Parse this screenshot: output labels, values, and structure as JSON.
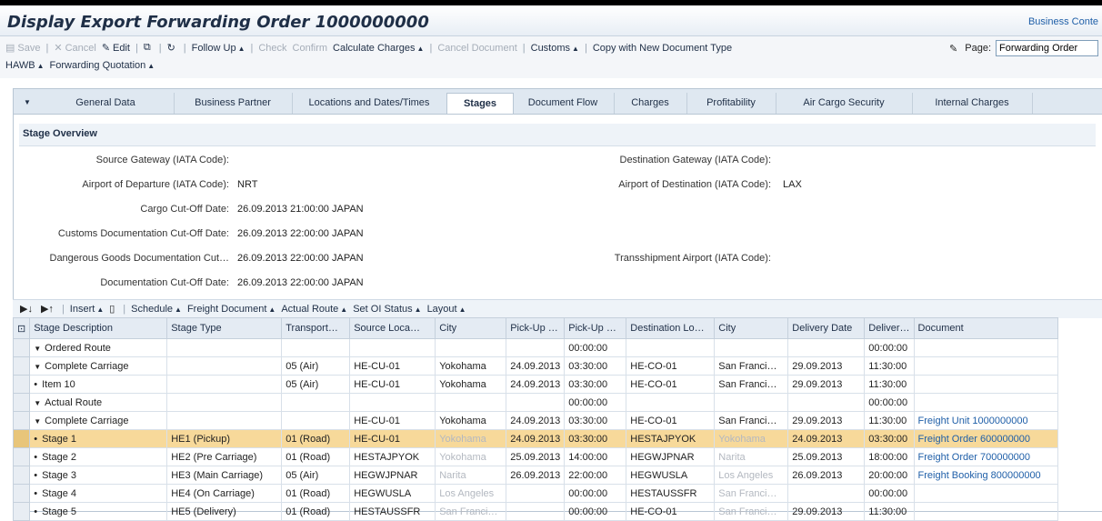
{
  "title": "Display Export Forwarding Order 1000000000",
  "business_context": "Business Conte",
  "toolbar": {
    "row1": [
      {
        "label": "Save",
        "disabled": true,
        "icon": "save-icon"
      },
      {
        "sep": true
      },
      {
        "label": "Cancel",
        "disabled": true,
        "icon": "cancel-icon"
      },
      {
        "label": "Edit",
        "disabled": false,
        "icon": "edit-icon"
      },
      {
        "sep": true
      },
      {
        "label": "",
        "disabled": false,
        "icon": "copy-icon"
      },
      {
        "sep": true
      },
      {
        "label": "",
        "disabled": false,
        "icon": "refresh-icon"
      },
      {
        "sep": true
      },
      {
        "label": "Follow Up",
        "disabled": false,
        "drop": true
      },
      {
        "sep": true
      },
      {
        "label": "Check",
        "disabled": true
      },
      {
        "label": "Confirm",
        "disabled": true
      },
      {
        "label": "Calculate Charges",
        "disabled": false,
        "drop": true
      },
      {
        "sep": true
      },
      {
        "label": "Cancel Document",
        "disabled": true
      },
      {
        "sep": true
      },
      {
        "label": "Customs",
        "disabled": false,
        "drop": true
      },
      {
        "sep": true
      },
      {
        "label": "Copy with New Document Type",
        "disabled": false
      }
    ],
    "row2": [
      {
        "label": "HAWB",
        "drop": true
      },
      {
        "label": "Forwarding Quotation",
        "drop": true
      }
    ],
    "page_label": "Page:",
    "page_value": "Forwarding Order"
  },
  "tabs": [
    "General Data",
    "Business Partner",
    "Locations and Dates/Times",
    "Stages",
    "Document Flow",
    "Charges",
    "Profitability",
    "Air Cargo Security",
    "Internal Charges"
  ],
  "active_tab": "Stages",
  "overview": {
    "heading": "Stage Overview",
    "left": [
      {
        "label": "Source Gateway (IATA Code):",
        "value": ""
      },
      {
        "label": "Airport of Departure (IATA Code):",
        "value": "NRT"
      },
      {
        "label": "Cargo Cut-Off Date:",
        "value": "26.09.2013 21:00:00 JAPAN"
      },
      {
        "label": "Customs Documentation Cut-Off Date:",
        "value": "26.09.2013 22:00:00 JAPAN"
      },
      {
        "label": "Dangerous Goods Documentation Cut…",
        "value": "26.09.2013 22:00:00 JAPAN"
      },
      {
        "label": "Documentation Cut-Off Date:",
        "value": "26.09.2013 22:00:00 JAPAN"
      }
    ],
    "right": [
      {
        "label": "Destination Gateway (IATA Code):",
        "value": ""
      },
      {
        "label": "Airport of Destination (IATA Code):",
        "value": "LAX"
      },
      {
        "label": "Transshipment Airport (IATA Code):",
        "value": ""
      }
    ]
  },
  "grid_toolbar": [
    "Insert",
    "Schedule",
    "Freight Document",
    "Actual Route",
    "Set OI Status",
    "Layout"
  ],
  "columns": [
    "Stage Description",
    "Stage Type",
    "Transport…",
    "Source Loca…",
    "City",
    "Pick-Up …",
    "Pick-Up …",
    "Destination Lo…",
    "City",
    "Delivery Date",
    "Deliver…",
    "Document"
  ],
  "rows": [
    {
      "level": 0,
      "tri": "▼",
      "desc": "Ordered Route",
      "cells": [
        "",
        "",
        "",
        "",
        "",
        "00:00:00",
        "",
        "",
        "",
        "00:00:00",
        ""
      ]
    },
    {
      "level": 1,
      "tri": "▼",
      "desc": "Complete Carriage",
      "cells": [
        "",
        "05 (Air)",
        "HE-CU-01",
        "Yokohama",
        "24.09.2013",
        "03:30:00",
        "HE-CO-01",
        "San Franci…",
        "29.09.2013",
        "11:30:00",
        ""
      ]
    },
    {
      "level": 2,
      "tri": "•",
      "desc": "Item 10",
      "cells": [
        "",
        "05 (Air)",
        "HE-CU-01",
        "Yokohama",
        "24.09.2013",
        "03:30:00",
        "HE-CO-01",
        "San Franci…",
        "29.09.2013",
        "11:30:00",
        ""
      ]
    },
    {
      "level": 0,
      "tri": "▼",
      "desc": "Actual Route",
      "cells": [
        "",
        "",
        "",
        "",
        "",
        "00:00:00",
        "",
        "",
        "",
        "00:00:00",
        ""
      ]
    },
    {
      "level": 1,
      "tri": "▼",
      "desc": "Complete Carriage",
      "cells": [
        "",
        "",
        "HE-CU-01",
        "Yokohama",
        "24.09.2013",
        "03:30:00",
        "HE-CO-01",
        "San Franci…",
        "29.09.2013",
        "11:30:00",
        "Freight Unit 1000000000"
      ]
    },
    {
      "level": 2,
      "tri": "•",
      "desc": "Stage 1",
      "hl": true,
      "cells": [
        "HE1 (Pickup)",
        "01 (Road)",
        "HE-CU-01",
        "Yokohama",
        "24.09.2013",
        "03:30:00",
        "HESTAJPYOK",
        "Yokohama",
        "24.09.2013",
        "03:30:00",
        "Freight Order 600000000"
      ]
    },
    {
      "level": 2,
      "tri": "•",
      "desc": "Stage 2",
      "cells": [
        "HE2 (Pre Carriage)",
        "01 (Road)",
        "HESTAJPYOK",
        "Yokohama",
        "25.09.2013",
        "14:00:00",
        "HEGWJPNAR",
        "Narita",
        "25.09.2013",
        "18:00:00",
        "Freight Order 700000000"
      ]
    },
    {
      "level": 2,
      "tri": "•",
      "desc": "Stage 3",
      "cells": [
        "HE3 (Main Carriage)",
        "05 (Air)",
        "HEGWJPNAR",
        "Narita",
        "26.09.2013",
        "22:00:00",
        "HEGWUSLA",
        "Los Angeles",
        "26.09.2013",
        "20:00:00",
        "Freight Booking 800000000"
      ]
    },
    {
      "level": 2,
      "tri": "•",
      "desc": "Stage 4",
      "cells": [
        "HE4 (On Carriage)",
        "01 (Road)",
        "HEGWUSLA",
        "Los Angeles",
        "",
        "00:00:00",
        "HESTAUSSFR",
        "San Franci…",
        "",
        "00:00:00",
        ""
      ]
    },
    {
      "level": 2,
      "tri": "•",
      "desc": "Stage 5",
      "cells": [
        "HE5 (Delivery)",
        "01 (Road)",
        "HESTAUSSFR",
        "San Franci…",
        "",
        "00:00:00",
        "HE-CO-01",
        "San Franci…",
        "29.09.2013",
        "11:30:00",
        ""
      ]
    }
  ]
}
